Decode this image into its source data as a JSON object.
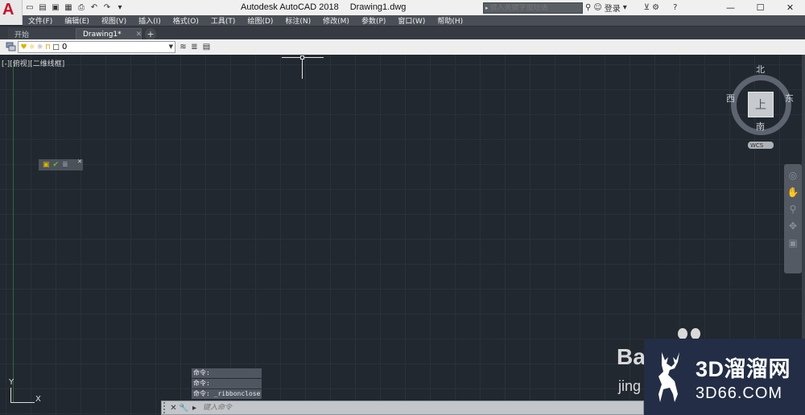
{
  "titlebar": {
    "app_name": "Autodesk AutoCAD 2018",
    "file_name": "Drawing1.dwg",
    "search_placeholder": "键入关键字或短语",
    "login_label": "登录"
  },
  "menubar": {
    "items": [
      "文件(F)",
      "编辑(E)",
      "视图(V)",
      "插入(I)",
      "格式(O)",
      "工具(T)",
      "绘图(D)",
      "标注(N)",
      "修改(M)",
      "参数(P)",
      "窗口(W)",
      "帮助(H)"
    ]
  },
  "tabs": {
    "start_label": "开始",
    "drawing_label": "Drawing1*",
    "add_label": "+"
  },
  "layer_toolbar": {
    "current_layer": "0"
  },
  "viewport": {
    "label": "[-][俯视][二维线框]"
  },
  "viewcube": {
    "north": "北",
    "south": "南",
    "west": "西",
    "east": "东",
    "face": "上",
    "ucs_label": "WCS"
  },
  "ucs_icon": {
    "y_label": "Y",
    "x_label": "X"
  },
  "command": {
    "history": [
      "命令:",
      "命令:",
      "命令: _ribbonclose"
    ],
    "input_placeholder": "键入命令"
  },
  "watermark": {
    "brand": "3D溜溜网",
    "site": "3D66.COM",
    "baidu_b": "Ba",
    "baidu_j": "jing"
  },
  "icons": [
    "autocad-logo-icon",
    "new-icon",
    "open-icon",
    "save-icon",
    "saveas-icon",
    "plot-icon",
    "undo-icon",
    "redo-icon",
    "search-icon",
    "binoculars-icon",
    "user-icon",
    "cart-icon",
    "exchange-icon",
    "help-icon",
    "minimize-icon",
    "maximize-icon",
    "close-icon",
    "layer-properties-icon",
    "bulb-icon",
    "sun-icon",
    "lock-icon",
    "color-swatch-icon",
    "make-current-icon",
    "layer-previous-icon",
    "match-layer-icon",
    "steeringwheel-icon",
    "pan-icon",
    "zoom-icon",
    "orbit-icon",
    "showmotion-icon"
  ]
}
